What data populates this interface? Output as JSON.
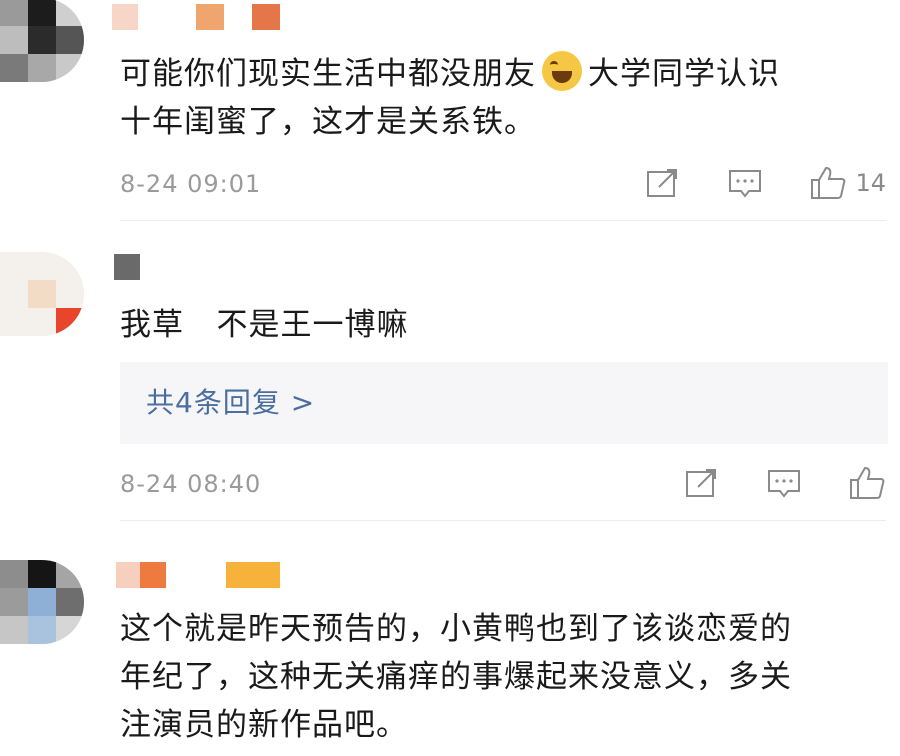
{
  "comments": [
    {
      "text_line1": "可能你们现实生活中都没朋友",
      "text_line1b": "大学同学认识",
      "text_line2": "十年闺蜜了，这才是关系铁。",
      "emoji": "laughing-tears-emoji",
      "time": "8-24 09:01",
      "likes": "14"
    },
    {
      "text_line1": "我草   不是王一博嘛",
      "replies": "共4条回复 >",
      "time": "8-24 08:40"
    },
    {
      "text_line1": "这个就是昨天预告的，小黄鸭也到了该谈恋爱的",
      "text_line2": "年纪了，这种无关痛痒的事爆起来没意义，多关",
      "text_line3": "注演员的新作品吧。"
    }
  ],
  "icons": {
    "share": "share-icon",
    "comment": "comment-icon",
    "like": "thumbs-up-icon"
  },
  "colors": {
    "meta_text": "#9a9a9a",
    "reply_link": "#4a6ea0",
    "reply_bg": "#f6f6f8"
  }
}
